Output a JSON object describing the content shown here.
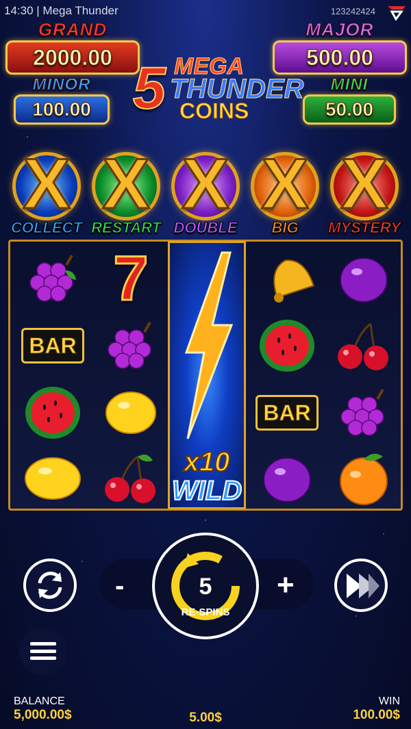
{
  "status_bar": {
    "title": "14:30 | Mega Thunder",
    "player_id": "123242424"
  },
  "jackpots": {
    "grand": {
      "label": "GRAND",
      "value": "2000.00"
    },
    "major": {
      "label": "MAJOR",
      "value": "500.00"
    },
    "minor": {
      "label": "MINOR",
      "value": "100.00"
    },
    "mini": {
      "label": "MINI",
      "value": "50.00"
    }
  },
  "game_logo": {
    "number": "5",
    "line1": "MEGA",
    "line2": "THUNDER",
    "line3": "COINS"
  },
  "features": [
    {
      "label": "COLLECT",
      "color": "#2fa8ff"
    },
    {
      "label": "RESTART",
      "color": "#38e04a"
    },
    {
      "label": "DOUBLE",
      "color": "#c25bff"
    },
    {
      "label": "BIG",
      "color": "#ff8a1e"
    },
    {
      "label": "MYSTERY",
      "color": "#ff3a2a"
    }
  ],
  "reels": [
    [
      "grapes",
      "bar",
      "watermelon",
      "lemon"
    ],
    [
      "seven",
      "grapes",
      "lemon",
      "cherries"
    ],
    [
      "wild"
    ],
    [
      "bell",
      "watermelon",
      "bar",
      "plum"
    ],
    [
      "plum",
      "cherries",
      "grapes",
      "orange"
    ]
  ],
  "symbols": {
    "bar_text": "BAR",
    "seven_text": "7"
  },
  "wild": {
    "multiplier": "x10",
    "label": "WILD"
  },
  "controls": {
    "minus": "-",
    "plus": "+",
    "respins_count": "5",
    "respins_label": "RE-SPINS"
  },
  "footer": {
    "balance_label": "BALANCE",
    "balance_value": "5,000.00$",
    "bet_value": "5.00$",
    "win_label": "WIN",
    "win_value": "100.00$"
  }
}
